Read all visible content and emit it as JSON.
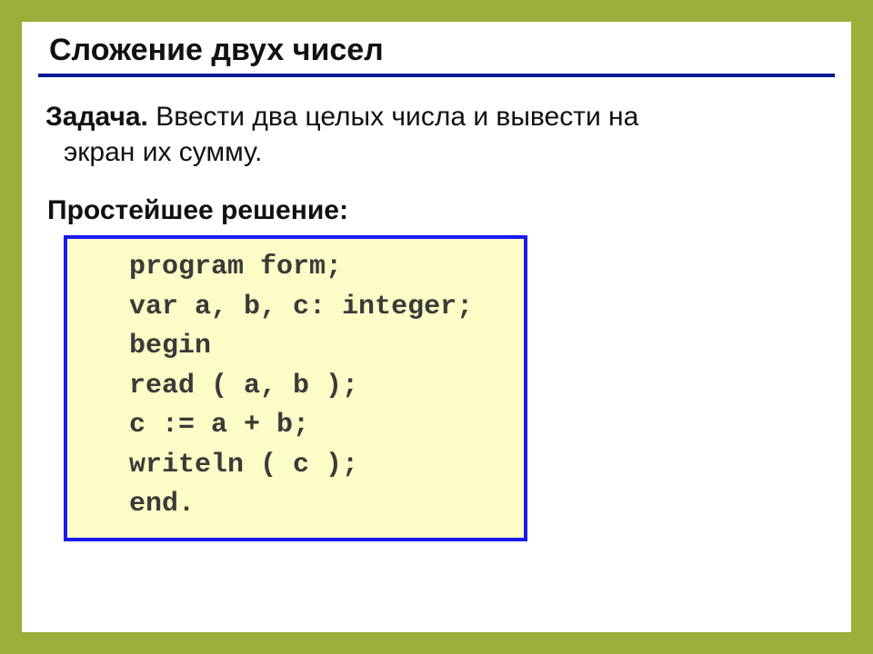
{
  "title": "Сложение двух чисел",
  "task": {
    "label": "Задача.",
    "text_line1": " Ввести два целых числа и вывести на",
    "text_line2": "экран их сумму."
  },
  "solution_label": "Простейшее решение:",
  "code": "   program form;\n   var a, b, c: integer;\n   begin\n   read ( a, b );\n   c := a + b;\n   writeln ( c );\n   end."
}
